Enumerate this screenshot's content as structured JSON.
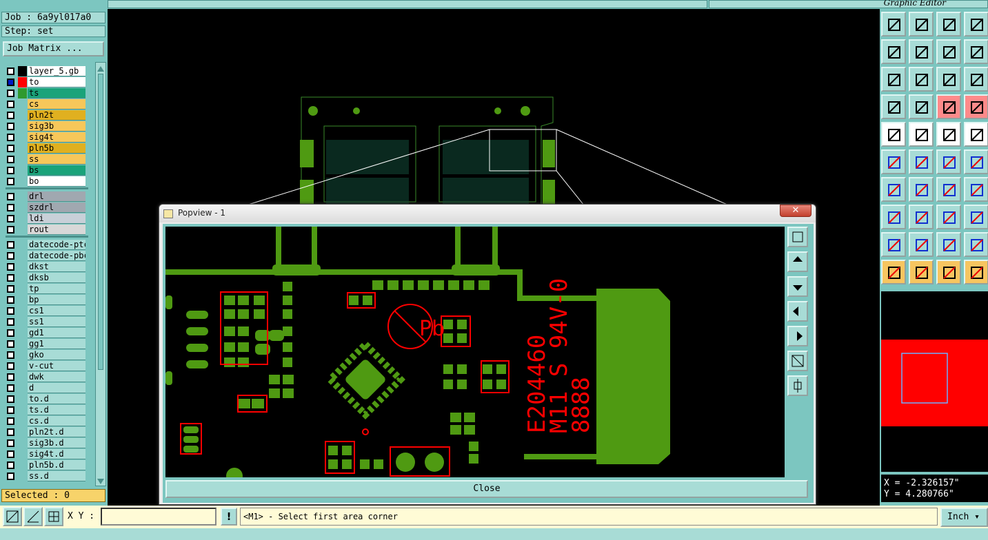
{
  "header": {
    "graphic_editor_label": "Graphic Editor"
  },
  "left_panel": {
    "job_label": "Job : 6a9yl017a0",
    "step_label": "Step: set",
    "job_matrix_button": "Job Matrix ...",
    "selected_label": "Selected : 0",
    "layers": [
      {
        "name": "layer_5.gb",
        "color": "#ffffff",
        "swatch": "#000000"
      },
      {
        "name": "to",
        "color": "#ffffff",
        "swatch": "#ff0000",
        "active": true
      },
      {
        "name": "ts",
        "color": "#1aa37a",
        "swatch": "#2f9a2f"
      },
      {
        "name": "cs",
        "color": "#f7c75a"
      },
      {
        "name": "pln2t",
        "color": "#e0b020"
      },
      {
        "name": "sig3b",
        "color": "#f7c75a"
      },
      {
        "name": "sig4t",
        "color": "#f7c75a"
      },
      {
        "name": "pln5b",
        "color": "#e0b020"
      },
      {
        "name": "ss",
        "color": "#f7c75a"
      },
      {
        "name": "bs",
        "color": "#1aa37a"
      },
      {
        "name": "bo",
        "color": "#ffffff"
      },
      {
        "name": "drl",
        "color": "#a0a8b0"
      },
      {
        "name": "szdrl",
        "color": "#a0a8b0"
      },
      {
        "name": "ldi",
        "color": "#c8d0d8"
      },
      {
        "name": "rout",
        "color": "#d8d8d8"
      },
      {
        "name": "datecode-ptc",
        "color": "#a8dcd6"
      },
      {
        "name": "datecode-pbc",
        "color": "#a8dcd6"
      },
      {
        "name": "dkst",
        "color": "#a8dcd6"
      },
      {
        "name": "dksb",
        "color": "#a8dcd6"
      },
      {
        "name": "tp",
        "color": "#a8dcd6"
      },
      {
        "name": "bp",
        "color": "#a8dcd6"
      },
      {
        "name": "cs1",
        "color": "#a8dcd6"
      },
      {
        "name": "ss1",
        "color": "#a8dcd6"
      },
      {
        "name": "gd1",
        "color": "#a8dcd6"
      },
      {
        "name": "gg1",
        "color": "#a8dcd6"
      },
      {
        "name": "gko",
        "color": "#a8dcd6"
      },
      {
        "name": "v-cut",
        "color": "#a8dcd6"
      },
      {
        "name": "dwk",
        "color": "#a8dcd6"
      },
      {
        "name": "d",
        "color": "#a8dcd6"
      },
      {
        "name": "to.d",
        "color": "#a8dcd6"
      },
      {
        "name": "ts.d",
        "color": "#a8dcd6"
      },
      {
        "name": "cs.d",
        "color": "#a8dcd6"
      },
      {
        "name": "pln2t.d",
        "color": "#a8dcd6"
      },
      {
        "name": "sig3b.d",
        "color": "#a8dcd6"
      },
      {
        "name": "sig4t.d",
        "color": "#a8dcd6"
      },
      {
        "name": "pln5b.d",
        "color": "#a8dcd6"
      },
      {
        "name": "ss.d",
        "color": "#a8dcd6"
      }
    ]
  },
  "popup": {
    "title": "Popview - 1",
    "close_button": "Close",
    "pcb_text_1": "E204460",
    "pcb_text_2": "M11 S 94V-0",
    "pcb_text_3": "8888",
    "pb_mark": "Pb"
  },
  "coords": {
    "x": "X = -2.326157\"",
    "y": "Y = 4.280766\""
  },
  "bottom": {
    "xy_label": "X Y :",
    "xy_value": "",
    "warn_label": "!",
    "message": "<M1> - Select first area corner",
    "units": "Inch"
  },
  "colors": {
    "panel": "#7cc6c0",
    "copper": "#4f9a12",
    "silk": "#ff0000"
  }
}
